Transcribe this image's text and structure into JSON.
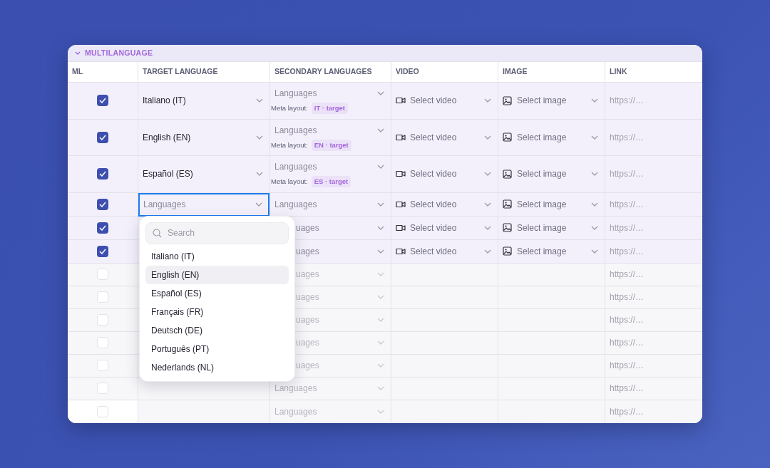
{
  "section": {
    "title": "MULTILANGUAGE",
    "expanded": true
  },
  "columns": [
    "ML",
    "TARGET LANGUAGE",
    "SECONDARY LANGUAGES",
    "VIDEO",
    "IMAGE",
    "LINK"
  ],
  "rows": [
    {
      "checked": true,
      "target": "Italiano (IT)",
      "secondary": "Languages",
      "meta_label": "Meta layout:",
      "meta_badge": "IT · target",
      "video": "Select video",
      "image": "Select image",
      "link": "https://…"
    },
    {
      "checked": true,
      "target": "English (EN)",
      "secondary": "Languages",
      "meta_label": "Meta layout:",
      "meta_badge": "EN · target",
      "video": "Select video",
      "image": "Select image",
      "link": "https://…"
    },
    {
      "checked": true,
      "target": "Español (ES)",
      "secondary": "Languages",
      "meta_label": "Meta layout:",
      "meta_badge": "ES · target",
      "video": "Select video",
      "image": "Select image",
      "link": "https://…"
    },
    {
      "checked": true,
      "target_placeholder": "Languages",
      "focused": true,
      "secondary": "Languages",
      "video": "Select video",
      "image": "Select image",
      "link": "https://…"
    },
    {
      "checked": true,
      "secondary": "uages",
      "video": "Select video",
      "image": "Select image",
      "link": "https://…"
    },
    {
      "checked": true,
      "secondary": "uages",
      "video": "Select video",
      "image": "Select image",
      "link": "https://…"
    },
    {
      "checked": false,
      "secondary": "uages",
      "link": "https://…"
    },
    {
      "checked": false,
      "secondary": "uages",
      "link": "https://…"
    },
    {
      "checked": false,
      "secondary": "uages",
      "link": "https://…"
    },
    {
      "checked": false,
      "secondary": "uages",
      "link": "https://…"
    },
    {
      "checked": false,
      "secondary": "uages",
      "link": "https://…"
    },
    {
      "checked": false,
      "secondary": "Languages",
      "link": "https://…"
    },
    {
      "checked": false,
      "secondary": "Languages",
      "link": "https://…"
    }
  ],
  "dropdown": {
    "search_placeholder": "Search",
    "items": [
      {
        "label": "Italiano (IT)",
        "selected": false
      },
      {
        "label": "English (EN)",
        "selected": true
      },
      {
        "label": "Español (ES)",
        "selected": false
      },
      {
        "label": "Français (FR)",
        "selected": false
      },
      {
        "label": "Deutsch (DE)",
        "selected": false
      },
      {
        "label": "Português (PT)",
        "selected": false
      },
      {
        "label": "Nederlands (NL)",
        "selected": false
      }
    ]
  }
}
